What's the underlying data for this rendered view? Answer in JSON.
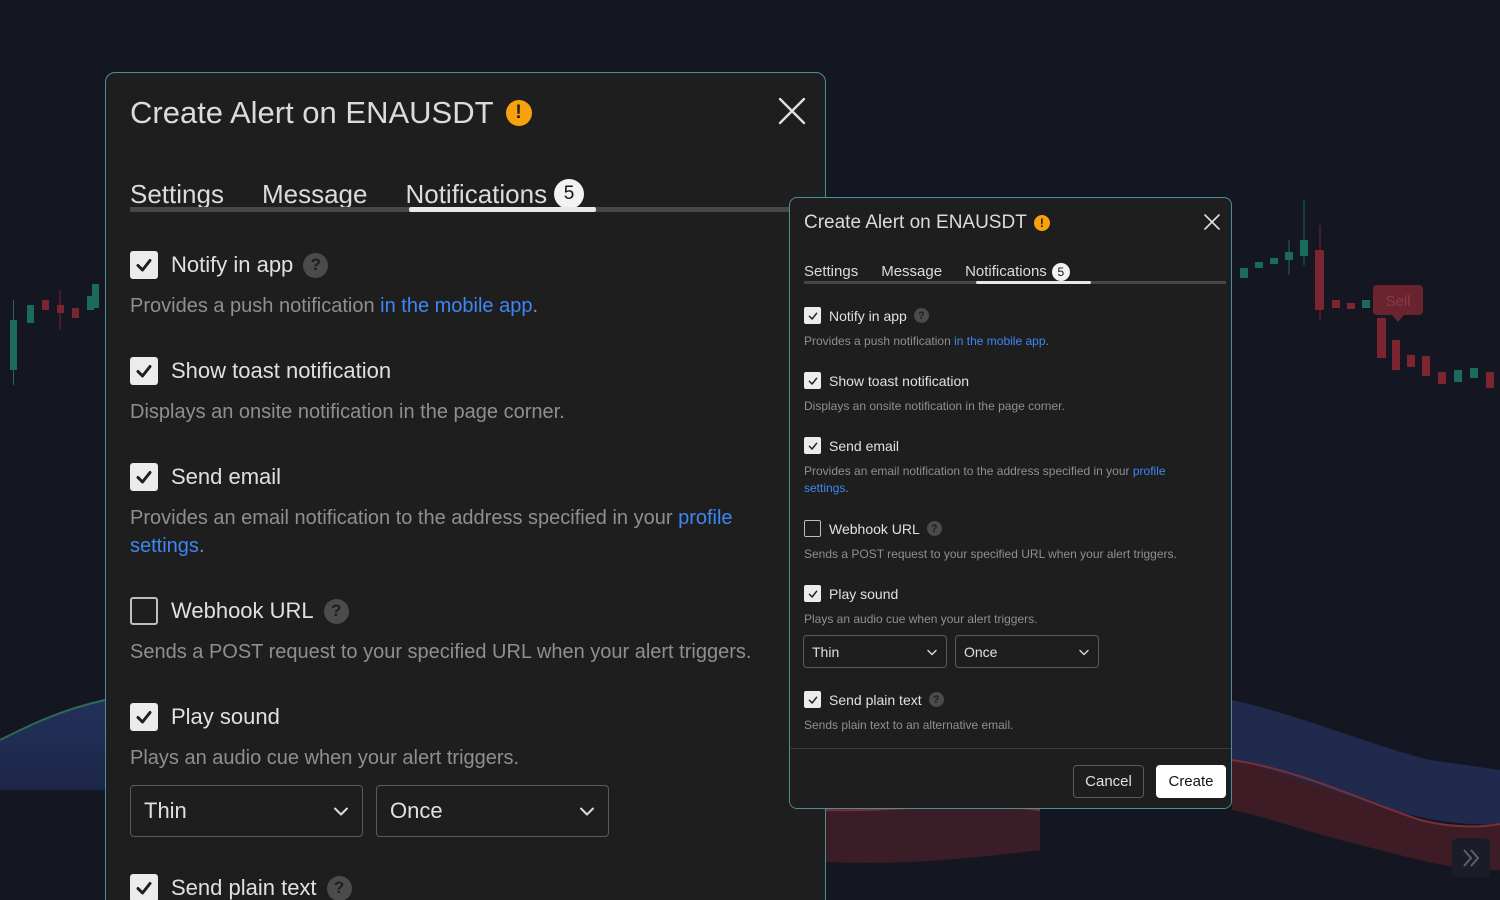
{
  "chart": {
    "sell_label": "Sell"
  },
  "colors": {
    "accent_link": "#3e86f2",
    "warning": "#f7a10c",
    "dialog_bg": "#1e1e1f",
    "dialog_border": "#4a8f95"
  },
  "dialog": {
    "title": "Create Alert on ENAUSDT",
    "warning_icon": "!",
    "tabs": [
      {
        "label": "Settings"
      },
      {
        "label": "Message"
      },
      {
        "label": "Notifications",
        "badge": "5"
      }
    ],
    "active_tab": "Notifications",
    "options": {
      "notify_in_app": {
        "label": "Notify in app",
        "checked": true,
        "help": "?",
        "desc_before": "Provides a push notification ",
        "desc_link": "in the mobile app",
        "desc_after": "."
      },
      "toast": {
        "label": "Show toast notification",
        "checked": true,
        "desc": "Displays an onsite notification in the page corner."
      },
      "email": {
        "label": "Send email",
        "checked": true,
        "desc_before": "Provides an email notification to the address specified in your ",
        "desc_link": "profile settings",
        "desc_after": "."
      },
      "webhook": {
        "label": "Webhook URL",
        "checked": false,
        "help": "?",
        "desc": "Sends a POST request to your specified URL when your alert triggers."
      },
      "sound": {
        "label": "Play sound",
        "checked": true,
        "desc": "Plays an audio cue when your alert triggers.",
        "sound_select": "Thin",
        "repeat_select": "Once"
      },
      "plain_text": {
        "label": "Send plain text",
        "checked": true,
        "help": "?",
        "desc": "Sends plain text to an alternative email."
      }
    },
    "buttons": {
      "cancel": "Cancel",
      "create": "Create"
    }
  }
}
